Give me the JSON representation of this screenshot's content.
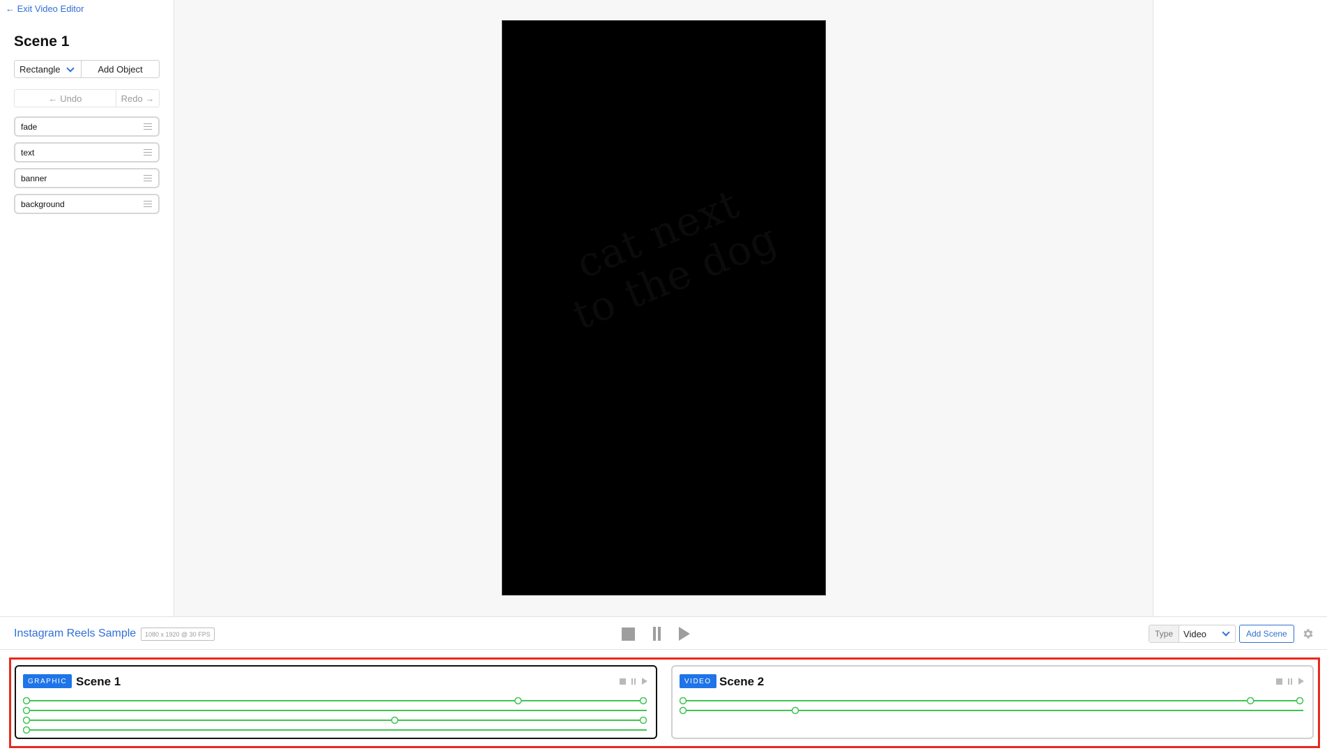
{
  "sidebar": {
    "exit_label": "← Exit Video Editor",
    "scene_title": "Scene 1",
    "shape_select_value": "Rectangle",
    "add_object_label": "Add Object",
    "undo_label": "← Undo",
    "redo_label": "Redo →",
    "layers": [
      {
        "label": "fade"
      },
      {
        "label": "text"
      },
      {
        "label": "banner"
      },
      {
        "label": "background"
      }
    ]
  },
  "preview": {
    "ghost_text": "cat next to the dog"
  },
  "toolbar": {
    "project_name": "Instagram Reels Sample",
    "project_meta": "1080 x 1920 @ 30 FPS",
    "type_label": "Type",
    "type_value": "Video",
    "add_scene_label": "Add Scene"
  },
  "scenes": [
    {
      "type": "GRAPHIC",
      "name": "Scene 1",
      "active": true,
      "tracks": [
        {
          "keyframes": [
            0,
            0.797,
            1
          ]
        },
        {
          "keyframes": [
            0
          ]
        },
        {
          "keyframes": [
            0,
            0.597,
            1
          ]
        },
        {
          "keyframes": [
            0
          ]
        }
      ]
    },
    {
      "type": "VIDEO",
      "name": "Scene 2",
      "active": false,
      "tracks": [
        {
          "keyframes": [
            0,
            0.92,
            1
          ]
        },
        {
          "keyframes": [
            0,
            0.182
          ]
        }
      ]
    }
  ],
  "colors": {
    "accent": "#2f6fd6",
    "badge": "#1f74e8",
    "track": "#3cc552",
    "highlight": "#e8291c"
  },
  "icons": [
    "arrow-left-icon",
    "chevron-down-icon",
    "drag-handle-icon",
    "stop-icon",
    "pause-icon",
    "play-icon",
    "gear-icon"
  ]
}
